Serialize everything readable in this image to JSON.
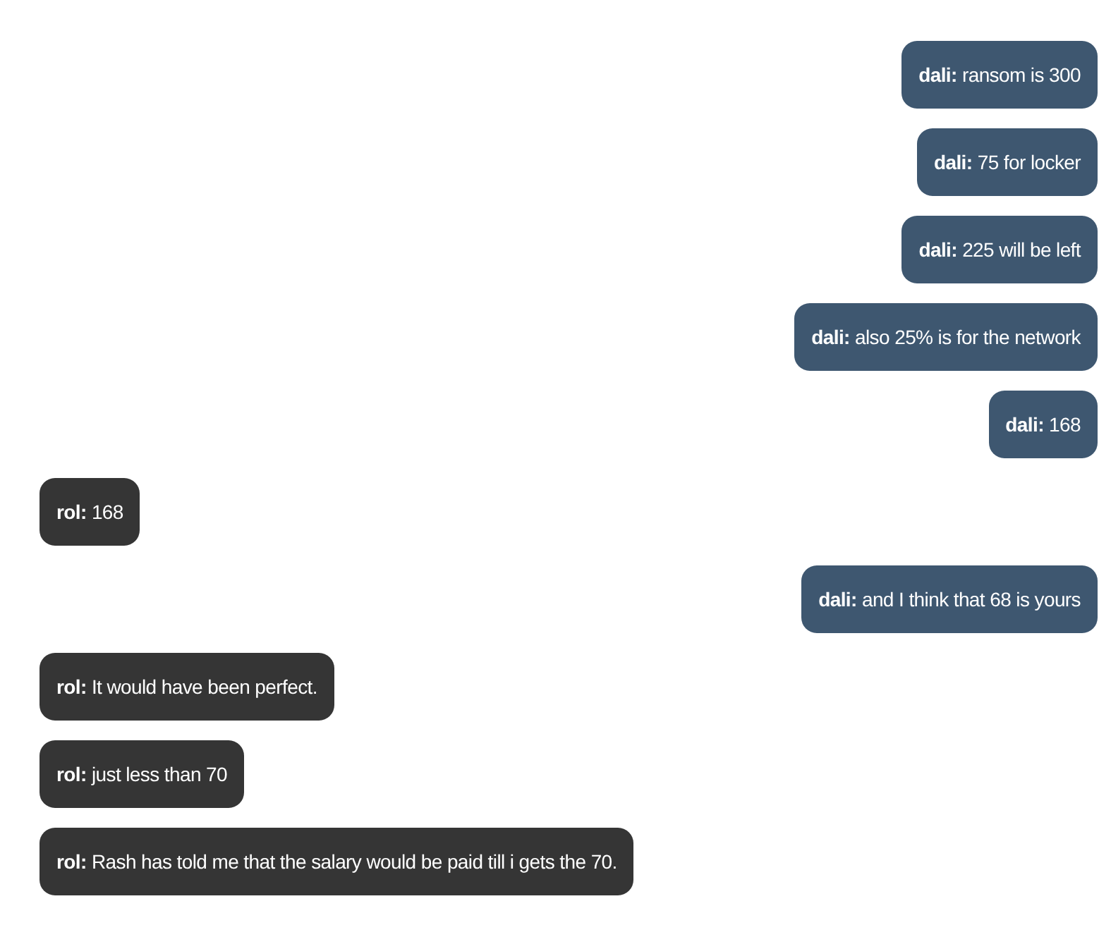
{
  "messages": [
    {
      "kind": "sent",
      "text": "**dali:** ransom is 300"
    },
    {
      "kind": "sent",
      "text": "**dali:** 75 for locker"
    },
    {
      "kind": "sent",
      "text": "**dali:** 225 will be left"
    },
    {
      "kind": "sent",
      "text": "**dali:** also 25% is for the network"
    },
    {
      "kind": "sent",
      "text": "**dali:** 168"
    },
    {
      "kind": "received",
      "text": "**rol:** 168"
    },
    {
      "kind": "sent",
      "text": "**dali:** and I think that 68 is yours"
    },
    {
      "kind": "received",
      "text": "**rol:** It would have been perfect."
    },
    {
      "kind": "received",
      "text": "**rol:** just less than 70"
    },
    {
      "kind": "received",
      "text": "**rol:** Rash has told me that the salary would be paid till i gets the 70."
    }
  ]
}
